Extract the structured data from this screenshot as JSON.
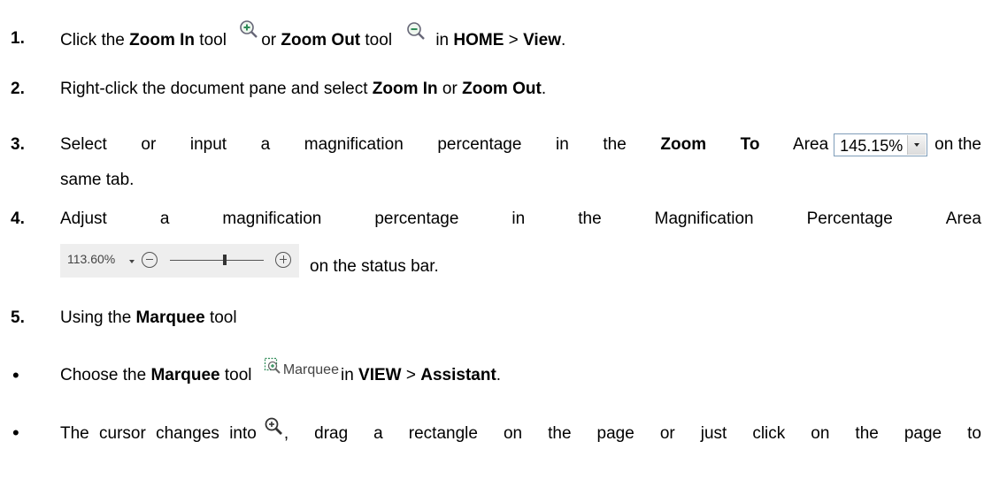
{
  "steps": {
    "s1": {
      "num": "1.",
      "a": "Click the ",
      "b1": "Zoom In",
      "c": " tool",
      "d": "or ",
      "b2": "Zoom Out",
      "e": " tool",
      "f": "in ",
      "b3": "HOME",
      "g": " > ",
      "b4": "View",
      "h": "."
    },
    "s2": {
      "num": "2.",
      "a": "Right-click the document pane and select ",
      "b1": "Zoom In",
      "c": " or ",
      "b2": "Zoom Out",
      "d": "."
    },
    "s3": {
      "num": "3.",
      "a": "Select or input a magnification percentage in the ",
      "b1": "Zoom To",
      "c": " Area",
      "zoom_value": "145.15%",
      "d": "on the",
      "e": "same tab."
    },
    "s4": {
      "num": "4.",
      "words": [
        "Adjust",
        "a",
        "magnification",
        "percentage",
        "in",
        "the",
        "Magnification",
        "Percentage",
        "Area"
      ],
      "status_value": "113.60%",
      "tail": "on the status bar."
    },
    "s5": {
      "num": "5.",
      "a": "Using the ",
      "b1": "Marquee",
      "c": " tool"
    },
    "b1": {
      "bullet": "•",
      "a": "Choose the ",
      "b1": "Marquee",
      "c": " tool",
      "tool_label": "Marquee",
      "d": "in ",
      "b2": "VIEW",
      "e": " > ",
      "b3": "Assistant",
      "f": "."
    },
    "b2": {
      "bullet": "•",
      "a": "The cursor changes into",
      "b": ", drag a rectangle on the page or just click on the page to"
    }
  },
  "icons": {
    "zoom_in": "zoom-in-icon",
    "zoom_out": "zoom-out-icon",
    "marquee": "marquee-icon",
    "cursor": "zoom-cursor-icon"
  },
  "colors": {
    "zoom_icon_accent": "#2e8b57",
    "box_border": "#7f9db9"
  }
}
